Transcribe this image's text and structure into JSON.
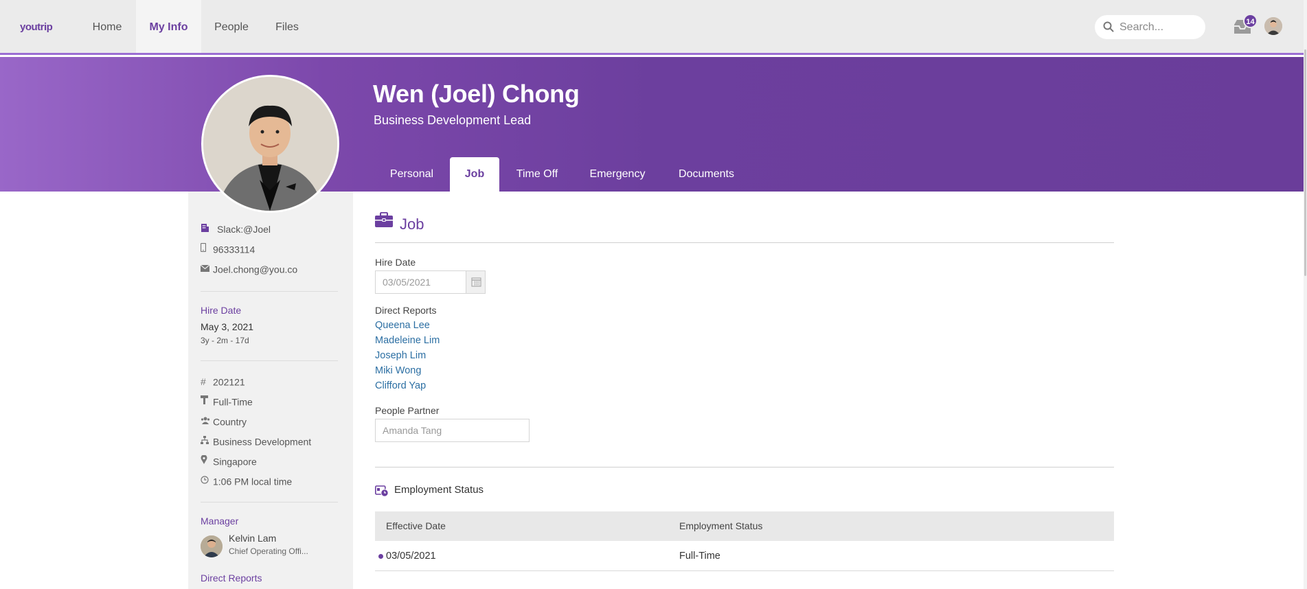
{
  "nav": {
    "logo": "youtrip",
    "items": [
      {
        "label": "Home"
      },
      {
        "label": "My Info"
      },
      {
        "label": "People"
      },
      {
        "label": "Files"
      }
    ],
    "search_placeholder": "Search...",
    "inbox_count": "14"
  },
  "profile": {
    "name": "Wen (Joel) Chong",
    "title": "Business Development Lead",
    "tabs": [
      {
        "label": "Personal"
      },
      {
        "label": "Job"
      },
      {
        "label": "Time Off"
      },
      {
        "label": "Emergency"
      },
      {
        "label": "Documents"
      }
    ]
  },
  "sidebar": {
    "slack": "Slack:@Joel",
    "phone": "96333114",
    "email": "Joel.chong@you.co",
    "hire_date_heading": "Hire Date",
    "hire_date": "May 3, 2021",
    "tenure": "3y - 2m - 17d",
    "employee_id": "202121",
    "employment_type": "Full-Time",
    "division": "Country",
    "department": "Business Development",
    "location": "Singapore",
    "local_time": "1:06 PM local time",
    "manager_heading": "Manager",
    "manager_name": "Kelvin Lam",
    "manager_title": "Chief Operating Offi...",
    "direct_reports_heading": "Direct Reports"
  },
  "job": {
    "section_title": "Job",
    "hire_date_label": "Hire Date",
    "hire_date_value": "03/05/2021",
    "direct_reports_label": "Direct Reports",
    "direct_reports": [
      "Queena Lee",
      "Madeleine Lim",
      "Joseph Lim",
      "Miki Wong",
      "Clifford Yap"
    ],
    "people_partner_label": "People Partner",
    "people_partner_value": "Amanda Tang",
    "employment_status": {
      "title": "Employment Status",
      "columns": [
        "Effective Date",
        "Employment Status"
      ],
      "rows": [
        {
          "effective_date": "03/05/2021",
          "status": "Full-Time"
        }
      ]
    }
  },
  "colors": {
    "brand": "#6b3fa0",
    "link": "#2c6fa3"
  }
}
